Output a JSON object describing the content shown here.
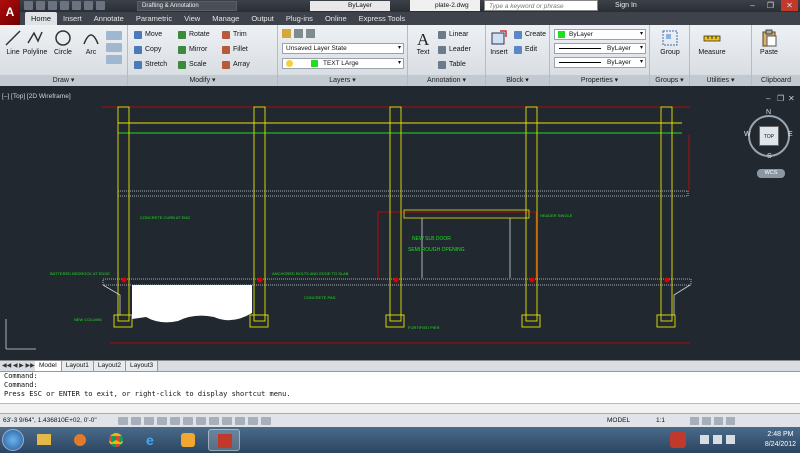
{
  "app": {
    "logo_letter": "A",
    "workspace": "Drafting & Annotation",
    "qat_bylayer": "ByLayer",
    "file_name": "plate-2.dwg",
    "search_placeholder": "Type a keyword or phrase",
    "sign_in": "Sign In",
    "window_buttons": [
      "–",
      "❐",
      "✕"
    ]
  },
  "ribbon_tabs": [
    "Home",
    "Insert",
    "Annotate",
    "Parametric",
    "View",
    "Manage",
    "Output",
    "Plug-ins",
    "Online",
    "Express Tools"
  ],
  "draw_panel": {
    "title": "Draw ▾",
    "line": "Line",
    "polyline": "Polyline",
    "circle": "Circle",
    "arc": "Arc"
  },
  "modify_panel": {
    "title": "Modify ▾",
    "move": "Move",
    "copy": "Copy",
    "stretch": "Stretch",
    "rotate": "Rotate",
    "mirror": "Mirror",
    "scale": "Scale",
    "trim": "Trim",
    "fillet": "Fillet",
    "array": "Array"
  },
  "layers_panel": {
    "title": "Layers ▾",
    "layer_state": "Unsaved Layer State",
    "current_layer": "TEXT LArge"
  },
  "annotation_panel": {
    "title": "Annotation ▾",
    "text": "Text",
    "linear": "Linear",
    "leader": "Leader",
    "table": "Table"
  },
  "block_panel": {
    "title": "Block ▾",
    "insert": "Insert",
    "create": "Create",
    "edit": "Edit"
  },
  "properties_panel": {
    "title": "Properties ▾",
    "color": "ByLayer",
    "linetype": "ByLayer",
    "lineweight": "ByLayer"
  },
  "groups_panel": {
    "title": "Groups ▾",
    "group": "Group"
  },
  "utilities_panel": {
    "title": "Utilities ▾",
    "measure": "Measure"
  },
  "clipboard_panel": {
    "title": "Clipboard",
    "paste": "Paste"
  },
  "viewport": {
    "label": "[–] [Top] [2D Wireframe]",
    "viewcube": {
      "top": "TOP",
      "n": "N",
      "s": "S",
      "e": "E",
      "w": "W",
      "wcs": "WCS"
    },
    "drawing_labels": [
      "NEW SLB DOOR",
      "SEMI ROUGH OPENING",
      "ANCHORED BOLTS AND EDGE TO SLAB",
      "BATTERED BEDROCK AT EDGE",
      "CONCRETE PAD",
      "HEADER SINGLE",
      "CONCRETE CURB AT END",
      "FORTIFIED PIER",
      "NEW COLUMN"
    ]
  },
  "sheet_tabs": [
    "Model",
    "Layout1",
    "Layout2",
    "Layout3"
  ],
  "command": {
    "lines": [
      "Command:",
      "Command:",
      "Press ESC or ENTER to exit, or right-click to display shortcut menu."
    ]
  },
  "status": {
    "coords": "63'-3 9/64\", 1.436810E+02, 0'-0\"",
    "model": "MODEL",
    "scale": "1:1"
  },
  "taskbar": {
    "time": "2:48 PM",
    "date": "8/24/2012"
  },
  "colors": {
    "canvas": "#212830",
    "structure_yellow": "#e6e600",
    "annotation_green": "#22dd22",
    "dimension_red": "#e00000"
  }
}
